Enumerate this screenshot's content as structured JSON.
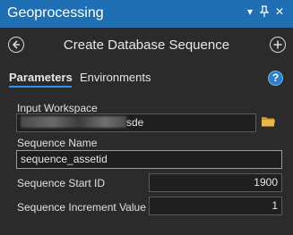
{
  "pane": {
    "title": "Geoprocessing",
    "controls": {
      "menu": "▾",
      "pin": "ᵖ",
      "close": "✕"
    }
  },
  "tool": {
    "title": "Create Database Sequence"
  },
  "tabs": [
    {
      "label": "Parameters",
      "active": true
    },
    {
      "label": "Environments",
      "active": false
    }
  ],
  "params": {
    "input_workspace": {
      "label": "Input Workspace",
      "value_suffix": "sde"
    },
    "sequence_name": {
      "label": "Sequence Name",
      "value": "sequence_assetid"
    },
    "start_id": {
      "label": "Sequence Start ID",
      "value": "1900"
    },
    "increment": {
      "label": "Sequence Increment Value",
      "value": "1"
    }
  },
  "icons": [
    "back-icon",
    "add-icon",
    "help-icon",
    "folder-icon"
  ],
  "colors": {
    "accent": "#1f6fb5",
    "background": "#2b2b2b",
    "folder": "#e8b84a"
  }
}
